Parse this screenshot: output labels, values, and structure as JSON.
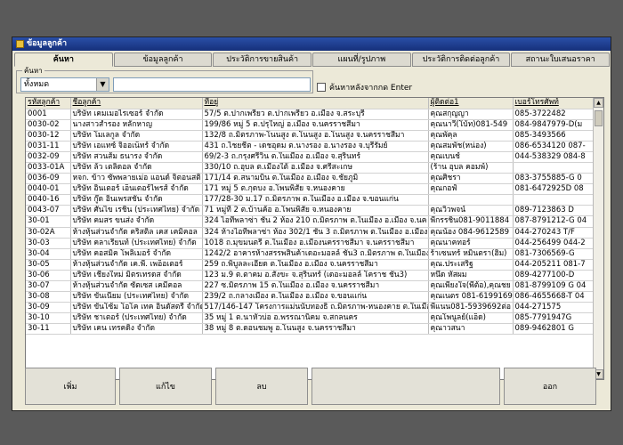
{
  "window": {
    "title": "ข้อมูลลูกค้า"
  },
  "tabs": [
    {
      "label": "ค้นหา",
      "active": true
    },
    {
      "label": "ข้อมูลลูกค้า",
      "active": false
    },
    {
      "label": "ประวัติการขายสินค้า",
      "active": false
    },
    {
      "label": "แผนที่/รูปภาพ",
      "active": false
    },
    {
      "label": "ประวัติการติดต่อลูกค้า",
      "active": false
    },
    {
      "label": "สถานะใบเสนอราคา",
      "active": false
    }
  ],
  "search": {
    "group_label": "ค้นหา",
    "filter_value": "ทั้งหมด",
    "query": "",
    "checkbox_label": "ค้นหาหลังจากกด Enter"
  },
  "table": {
    "columns": [
      "รหัสลูกค้า",
      "ชื่อลูกค้า",
      "ที่อยู่",
      "ผู้ติดต่อ1",
      "เบอร์โทรศัพท์"
    ],
    "rows": [
      [
        "0001",
        "บริษัท เคมเมอไรเซอร์ จำกัด",
        "57/5 ต.ปากเพรียว ต.ปากเพรียว อ.เมือง จ.สระบุรี",
        "คุณสกุญญา",
        "085-3722482"
      ],
      [
        "0030-02",
        "นางสาวสำรอง หลักหาญ",
        "199/86 หมู่ 5 ต.ปรุใหญ่ อ.เมือง จ.นครราชสีมา",
        "คุณนาวี(โบ้ท)081-549",
        "084-9847979-D(ม"
      ],
      [
        "0030-12",
        "บริษัท โมเลกูล จำกัด",
        "132/8 ถ.มิตรภาพ-โนนสูง ต.โนนสูง อ.โนนสูง จ.นครราชสีมา",
        "คุณพัคุล",
        "085-3493566"
      ],
      [
        "0031-11",
        "บริษัท เอแทซ์ จิออเน็ทร์ จำกัด",
        "431 ถ.ไชยชีต - เดชอุดม ต.นางรอง อ.นางรอง จ.บุรีรัมย์",
        "คุณสมพัช(หน่อง)",
        "086-6534120 087-"
      ],
      [
        "0032-09",
        "บริษัท สวนส้ม ธนารง จำกัด",
        "69/2-3 ถ.กรุงศรีวิน ต.ในเมือง อ.เมือง จ.สุรินทร์",
        "คุณเบนช์",
        "044-538329 084-8"
      ],
      [
        "0033-01A",
        "บริษัท ล้ว เตลิดอล จำกัด",
        "330/10 ถ.อุบล ต.เมืองใต้ อ.เมือง จ.ศรีสะเกษ",
        "(ร้าน อุบล คอมพ์)",
        ""
      ],
      [
        "0036-09",
        "หจก. ข้าว ซัพพลายเม่อ แอนด์ จิตอนสติ",
        "171/14 ต.สนามบิน ต.ในเมือง อ.เมือง จ.ชัยภูมิ",
        "คุณศิชรา",
        "083-3755885-G 0"
      ],
      [
        "0040-01",
        "บริษัท อินเตอร์ เอ็นเตอร์ไพรส์ จำกัด",
        "171 หมู่ 5 ต.กุดบง อ.โพนพิสัย จ.หนองคาย",
        "คุณกอฟ์",
        "081-6472925D 08"
      ],
      [
        "0040-16",
        "บริษัท กู๊ด อินเพรสชั่น จำกัด",
        "177/28-30 ม.17 ถ.มิตรภาพ ต.ในเมือง อ.เมือง จ.ขอนแก่น",
        "",
        ""
      ],
      [
        "0043-07",
        "บริษัท ศันไข เรชิ่น (ประเทศไทย) จำกัด",
        "71 หมู่ที่ 2 ต.บ้านค้อ อ.โพนพิสัย จ.หนองคาย",
        "คุณวิวพจน์",
        "089-7123863 D"
      ],
      [
        "30-01",
        "บริษัท คมสร ขนส่ง จำกัด",
        "324 ไอทีพลาซ่า ชั้น 2 ห้อง 210 ถ.มิตรภาพ ต.ในเมือง อ.เมือง จ.นค",
        "พี่กรรชิน081-9011884",
        "087-8791212-G 04"
      ],
      [
        "30-02A",
        "ห้างหุ้นส่วนจำกัด คริสติล เคส เคมิคอล",
        "324 ห้างไอทีพลาซ่า ห้อง 302/1 ชั้น 3 ถ.มิตรภาพ ต.ในเมือง อ.เมือง",
        "คุณน้อง 084-9612589",
        "044-270243 T/F"
      ],
      [
        "30-03",
        "บริษัท คลาเรียนท์ (ประเทศไทย) จำกัด",
        "1018 ถ.มุขมนตรี ต.ในเมือง อ.เมืองนครราชสีมา จ.นครราชสีมา",
        "คุณนาคทอร์",
        "044-256499 044-2"
      ],
      [
        "30-04",
        "บริษัท คอสมิค โพลิเมอร์ จำกัด",
        "1242/2 อาคารห้างสรรพสินค้าเดอะมอลล์ ชั้น3 ถ.มิตรภาพ ต.ในเมือง",
        "ร้าเซนทร์ หมินตรา(ฮิ้ม)",
        "081-7306569-G"
      ],
      [
        "30-05",
        "ห้างหุ้นส่วนจำกัด เค.พี. เพอ็อเตอร์",
        "259 ถ.พิบูลละเอียด ต.ในเมือง อ.เมือง จ.นครราชสีมา",
        "คุณ.ประเสริฐ",
        "044-205211 081-7"
      ],
      [
        "30-06",
        "บริษัท เชียงใหม่ มิตรเทรดส จำกัด",
        "123 ม.9 ต.ตาคม อ.สังขะ จ.สุรินทร์ (เดอะมอลล์ โคราช ชั้น3)",
        "หนึ่ด หัสผม",
        "089-4277100-D"
      ],
      [
        "30-07",
        "ห้างหุ้นส่วนจำกัด ซัตเซส เคมีคอล",
        "227 ซ.มิตรภาพ 15 ต.ในเมือง อ.เมือง จ.นครราชสีมา",
        "คุณเพียงใจ(พี่ต้อ),คุณชย",
        "081-8799109 G 04"
      ],
      [
        "30-08",
        "บริษัท ขันเนียม (ประเทศไทย) จำกัด",
        "239/2 ถ.กลางเมือง ต.ในเมือง อ.เมือง จ.ขอนแก่น",
        "คุณเนตร 081-6199169",
        "086-4655668-T 04"
      ],
      [
        "30-09",
        "บริษัท ขันโซ้ม โอโค เทค อินดัสตรี จำกัด",
        "517/146-147 โครงการแม่นนับทองธิ ถ.มิตรภาพ-หนองคาย ต.ในเมือง",
        "พี่แนน081-5939692ต่อ",
        "044-271575"
      ],
      [
        "30-10",
        "บริษัท ชาเตอร์ (ประเทศไทย) จำกัด",
        "35 หมู่ 1 ต.นาหัวบ่อ อ.พรรณานิคม จ.สกลนคร",
        "คุณโพนูลย์(แอ็ด)",
        "085-7791947G"
      ],
      [
        "30-11",
        "บริษัท เคน เทรคดิ้ง จำกัด",
        "38 หมู่ 8 ต.ดอนชมพู อ.โนนสูง จ.นครราชสีมา",
        "คุณาวสนา",
        "089-9462801 G"
      ]
    ]
  },
  "buttons": {
    "add": "เพิ่ม",
    "edit": "แก้ไข",
    "delete": "ลบ",
    "exit": "ออก"
  },
  "colors": {
    "titlebar": "#16307a",
    "window_bg": "#ece9d8",
    "backdrop": "#5a5a5a"
  }
}
